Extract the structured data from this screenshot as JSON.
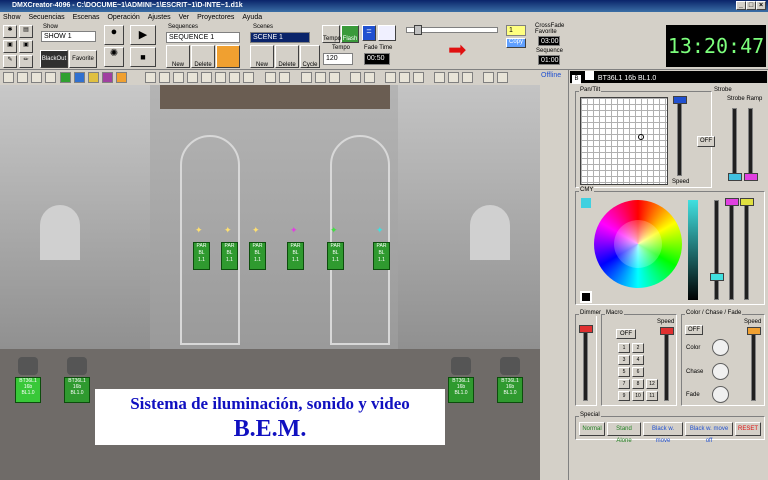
{
  "window": {
    "title": "DMXCreator-4096 - C:\\DOCUME~1\\ADMINI~1\\ESCRIT~1\\D-INTE~1.d1k",
    "btn_min": "_",
    "btn_max": "□",
    "btn_close": "×"
  },
  "menu": [
    "Show",
    "Secuencias",
    "Escenas",
    "Operación",
    "Ajustes",
    "Ver",
    "Proyectores",
    "Ayuda"
  ],
  "toolbar": {
    "show_label": "Show",
    "show_value": "SHOW 1",
    "blackout": "BlackOut",
    "favorite": "Favorite",
    "sequences_label": "Sequences",
    "sequence_value": "SEQUENCE 1",
    "scenes_label": "Scenes",
    "scene_value": "SCENE 1",
    "new": "New",
    "delete": "Delete",
    "tempo_label": "Tempo",
    "tempo_value": "120",
    "cycle": "Cycle",
    "fade_label": "Fade Time",
    "fade_value": "00:50",
    "tempo_btn": "Tempo",
    "flash_btn": "Flash",
    "copy": "Copy",
    "step_value": "1",
    "crossfade_label": "CrossFade",
    "favorite_label": "Favorite",
    "crossfade_value": "03:00",
    "sequence_label": "Sequence",
    "sequence_time": "01:00",
    "clock": "13:20:47"
  },
  "offline": "Offline",
  "fixtures_top": [
    {
      "l1": "PAR",
      "l2": "BL",
      "l3": "1.1"
    },
    {
      "l1": "PAR",
      "l2": "BL",
      "l3": "1.1"
    },
    {
      "l1": "PAR",
      "l2": "BL",
      "l3": "1.1"
    },
    {
      "l1": "PAR",
      "l2": "BL",
      "l3": "1.1"
    },
    {
      "l1": "PAR",
      "l2": "BL",
      "l3": "1.1"
    },
    {
      "l1": "PAR",
      "l2": "BL",
      "l3": "1.1"
    }
  ],
  "fixtures_bottom": [
    {
      "l1": "BT36L1",
      "l2": "16b",
      "l3": "BL1.0"
    },
    {
      "l1": "BT36L1",
      "l2": "16b",
      "l3": "BL1.0"
    },
    {
      "l1": "BT36L1",
      "l2": "16b",
      "l3": "BL1.0"
    },
    {
      "l1": "BT36L1",
      "l2": "16b",
      "l3": "BL1.0"
    }
  ],
  "banner": {
    "line1": "Sistema de iluminación, sonido y video",
    "line2": "B.E.M."
  },
  "panel": {
    "fixture_title": "BT36L1 16b BL1.0",
    "fixture_b": "B",
    "pantilt": "Pan/Tilt",
    "speed": "Speed",
    "strobe": "Strobe",
    "strobe_ramp": "Strobe Ramp",
    "off": "OFF",
    "cmy": "CMY",
    "dimmer": "Dimmer",
    "macro": "Macro",
    "macro_speed": "Speed",
    "color_chase_fade": "Color / Chase / Fade",
    "color_speed": "Speed",
    "color": "Color",
    "chase": "Chase",
    "fade": "Fade",
    "macro_buttons": [
      "1",
      "2",
      "3",
      "4",
      "5",
      "6",
      "7",
      "8",
      "9",
      "10",
      "11",
      "12"
    ],
    "special": "Special",
    "special_buttons": [
      "Normal",
      "Stand Alone",
      "Black w. move",
      "Black w. move off",
      "RESET"
    ]
  },
  "colors": {
    "accent_green": "#2f9a2f",
    "clock_fg": "#7cff7c",
    "banner_text": "#1010c0",
    "arrow_red": "#e01010"
  }
}
